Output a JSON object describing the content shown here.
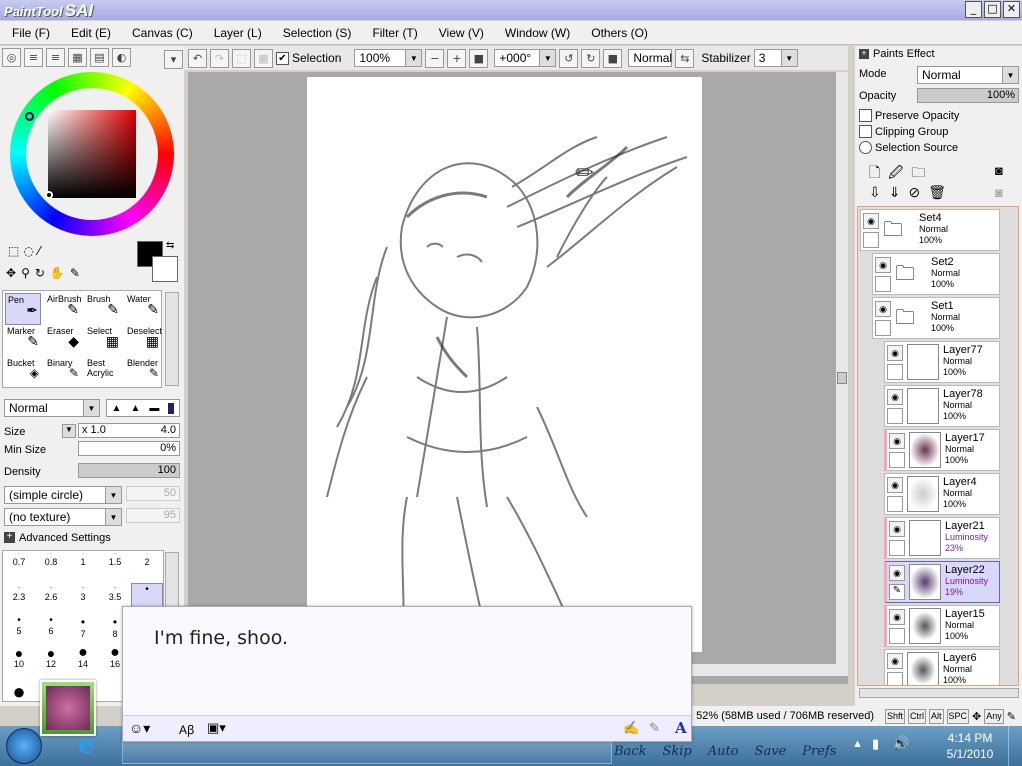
{
  "app": {
    "name_small": "PaintTool",
    "name_big": "SAI"
  },
  "window_buttons": [
    "_",
    "□",
    "✕"
  ],
  "menu": [
    {
      "label": "File (F)"
    },
    {
      "label": "Edit (E)"
    },
    {
      "label": "Canvas (C)"
    },
    {
      "label": "Layer (L)"
    },
    {
      "label": "Selection (S)"
    },
    {
      "label": "Filter (T)"
    },
    {
      "label": "View (V)"
    },
    {
      "label": "Window (W)"
    },
    {
      "label": "Others (O)"
    }
  ],
  "toolbar": {
    "selection_label": "Selection",
    "zoom": "100%",
    "rotation": "+000°",
    "blend_mode": "Normal",
    "stabilizer_label": "Stabilizer",
    "stabilizer_value": "3"
  },
  "tools": {
    "items": [
      {
        "label": "Pen",
        "selected": true
      },
      {
        "label": "AirBrush"
      },
      {
        "label": "Brush"
      },
      {
        "label": "Water"
      },
      {
        "label": "Marker"
      },
      {
        "label": "Eraser"
      },
      {
        "label": "Select"
      },
      {
        "label": "Deselect"
      },
      {
        "label": "Bucket"
      },
      {
        "label": "Binary"
      },
      {
        "label": "Best Acrylic"
      },
      {
        "label": "Blender"
      }
    ],
    "mode": "Normal",
    "size_label": "Size",
    "size_mult": "x 1.0",
    "size_value": "4.0",
    "minsize_label": "Min Size",
    "minsize_value": "0%",
    "density_label": "Density",
    "density_value": "100",
    "shape": "(simple circle)",
    "shape_value": "50",
    "texture": "(no texture)",
    "texture_value": "95",
    "advanced_label": "Advanced Settings",
    "brush_sizes": [
      [
        "0.7",
        "0.8",
        "1",
        "1.5",
        "2"
      ],
      [
        "2.3",
        "2.6",
        "3",
        "3.5",
        ""
      ],
      [
        "5",
        "6",
        "7",
        "8",
        ""
      ],
      [
        "10",
        "12",
        "14",
        "16",
        ""
      ]
    ]
  },
  "right": {
    "paints_effect_label": "Paints Effect",
    "mode_label": "Mode",
    "mode_value": "Normal",
    "opacity_label": "Opacity",
    "opacity_value": "100%",
    "preserve_opacity": "Preserve Opacity",
    "clipping_group": "Clipping Group",
    "selection_source": "Selection Source",
    "layers": [
      {
        "name": "Set4",
        "mode": "Normal",
        "opacity": "100%"
      },
      {
        "name": "Set2",
        "mode": "Normal",
        "opacity": "100%"
      },
      {
        "name": "Set1",
        "mode": "Normal",
        "opacity": "100%"
      },
      {
        "name": "Layer77",
        "mode": "Normal",
        "opacity": "100%"
      },
      {
        "name": "Layer78",
        "mode": "Normal",
        "opacity": "100%"
      },
      {
        "name": "Layer17",
        "mode": "Normal",
        "opacity": "100%"
      },
      {
        "name": "Layer4",
        "mode": "Normal",
        "opacity": "100%"
      },
      {
        "name": "Layer21",
        "mode": "Luminosity",
        "opacity": "23%"
      },
      {
        "name": "Layer22",
        "mode": "Luminosity",
        "opacity": "19%"
      },
      {
        "name": "Layer15",
        "mode": "Normal",
        "opacity": "100%"
      },
      {
        "name": "Layer6",
        "mode": "Normal",
        "opacity": "100%"
      }
    ]
  },
  "status": {
    "memory": "ad: 52% (58MB used / 706MB reserved)",
    "keys": [
      "Shft",
      "Ctrl",
      "Alt",
      "SPC",
      "Any"
    ]
  },
  "dialog": {
    "text": "I'm fine, shoo."
  },
  "overlay_menu": [
    "Back",
    "Skip",
    "Auto",
    "Save",
    "Prefs"
  ],
  "clock": {
    "time": "4:14 PM",
    "date": "5/1/2010"
  },
  "colors": {
    "accent": "#c8ccf0",
    "dialog": "#fafafe",
    "luminosity": "#7a1aa0"
  }
}
